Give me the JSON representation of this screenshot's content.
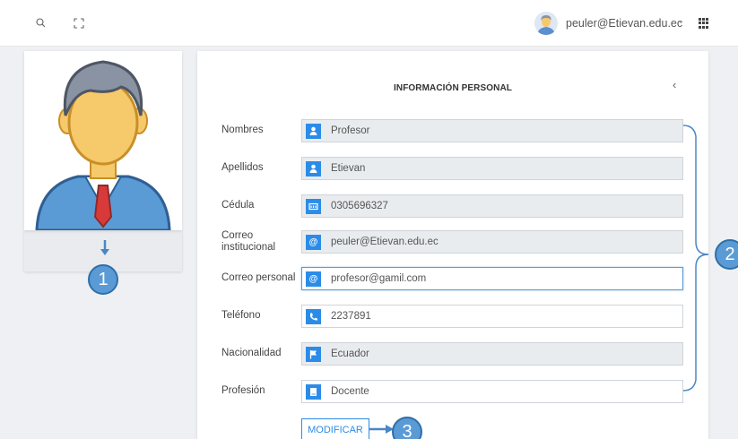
{
  "topbar": {
    "search_icon": "search-icon",
    "fullscreen_icon": "fullscreen-icon",
    "user_email": "peuler@Etievan.edu.ec",
    "caret": "⌄",
    "apps_icon": "apps-grid-icon"
  },
  "profile": {
    "avatar_icon": "teacher-avatar-icon"
  },
  "annotations": {
    "one": "1",
    "two": "2",
    "three": "3"
  },
  "form": {
    "title": "INFORMACIÓN PERSONAL",
    "back_icon": "‹",
    "fields": [
      {
        "label": "Nombres",
        "value": "Profesor",
        "icon": "user-icon"
      },
      {
        "label": "Apellidos",
        "value": "Etievan",
        "icon": "user-icon"
      },
      {
        "label": "Cédula",
        "value": "0305696327",
        "icon": "id-card-icon"
      },
      {
        "label": "Correo institucional",
        "value": "peuler@Etievan.edu.ec",
        "icon": "at-icon"
      },
      {
        "label": "Correo personal",
        "value": "profesor@gamil.com",
        "icon": "at-icon"
      },
      {
        "label": "Teléfono",
        "value": "2237891",
        "icon": "phone-icon"
      },
      {
        "label": "Nacionalidad",
        "value": "Ecuador",
        "icon": "flag-icon"
      },
      {
        "label": "Profesión",
        "value": "Docente",
        "icon": "book-icon"
      }
    ],
    "submit_label": "MODIFICAR"
  },
  "colors": {
    "accent": "#2b8ce8",
    "badge": "#5b9bd5",
    "readonly_field": "#e9ecef",
    "background": "#eef0f3"
  }
}
